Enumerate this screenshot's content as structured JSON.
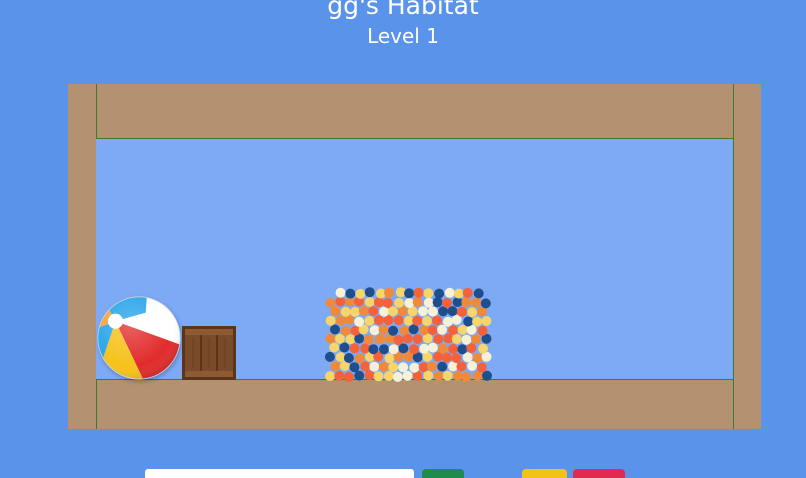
{
  "header": {
    "title": "gg's Habitat",
    "level": "Level 1"
  },
  "colors": {
    "background": "#5a93ea",
    "habitat_wall": "#b39171",
    "play_area": "#7eaaf5",
    "wall_line": "#3f7a2b",
    "crate_wood": "#7a4b2a",
    "ball_pit_colors": [
      "#f7d56a",
      "#ef8a3c",
      "#f4613a",
      "#1f4e8c",
      "#f7f1d8"
    ]
  },
  "toys": [
    {
      "name": "beach-ball",
      "icon": "beach-ball-icon",
      "colors": [
        "#e22b2b",
        "#f6c21b",
        "#2aa5e8",
        "#ffffff"
      ]
    },
    {
      "name": "wooden-crate",
      "icon": "crate-icon"
    },
    {
      "name": "ball-pit",
      "icon": "ball-pit-icon"
    }
  ],
  "controls": {
    "name_input_value": "",
    "name_input_placeholder": "",
    "green_button_color": "#1f8b4c",
    "yellow_button_color": "#f2c218",
    "red_button_color": "#e2294f"
  }
}
